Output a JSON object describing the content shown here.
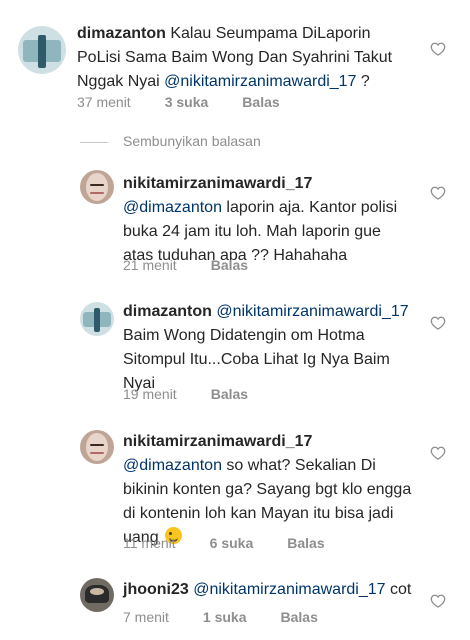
{
  "comments": [
    {
      "username": "dimazanton",
      "text": "Kalau Seumpama DiLaporin PoLisi Sama Baim Wong Dan Syahrini Takut Nggak Nyai",
      "mention": "@nikitamirzanimawardi_17",
      "after_mention": " ?",
      "time": "37 menit",
      "likes": "3 suka",
      "reply": "Balas"
    }
  ],
  "hide_replies_label": "Sembunyikan balasan",
  "replies": [
    {
      "username": "nikitamirzanimawardi_17",
      "mention": "@dimazanton",
      "text": " laporin aja. Kantor polisi buka 24 jam itu loh. Mah laporin gue atas tuduhan apa ?? Hahahaha",
      "time": "21 menit",
      "reply": "Balas"
    },
    {
      "username": "dimazanton",
      "mention": "@nikitamirzanimawardi_17",
      "text": "Baim Wong Didatengin om Hotma Sitompul Itu...Coba Lihat Ig Nya Baim Nyai",
      "time": "19 menit",
      "reply": "Balas"
    },
    {
      "username": "nikitamirzanimawardi_17",
      "mention": "@dimazanton",
      "text": " so what? Sekalian Di bikinin konten ga? Sayang bgt klo engga di kontenin loh kan Mayan itu bisa jadi uang",
      "emoji": "wink-emoji",
      "time": "11 menit",
      "likes": "6 suka",
      "reply": "Balas"
    },
    {
      "username": "jhooni23",
      "mention": "@nikitamirzanimawardi_17",
      "text": " cot",
      "time": "7 menit",
      "likes": "1 suka",
      "reply": "Balas"
    }
  ],
  "colors": {
    "text": "#262626",
    "mention": "#003569",
    "meta": "#8e8e8e"
  },
  "icons": {
    "like": "heart-outline-icon"
  }
}
